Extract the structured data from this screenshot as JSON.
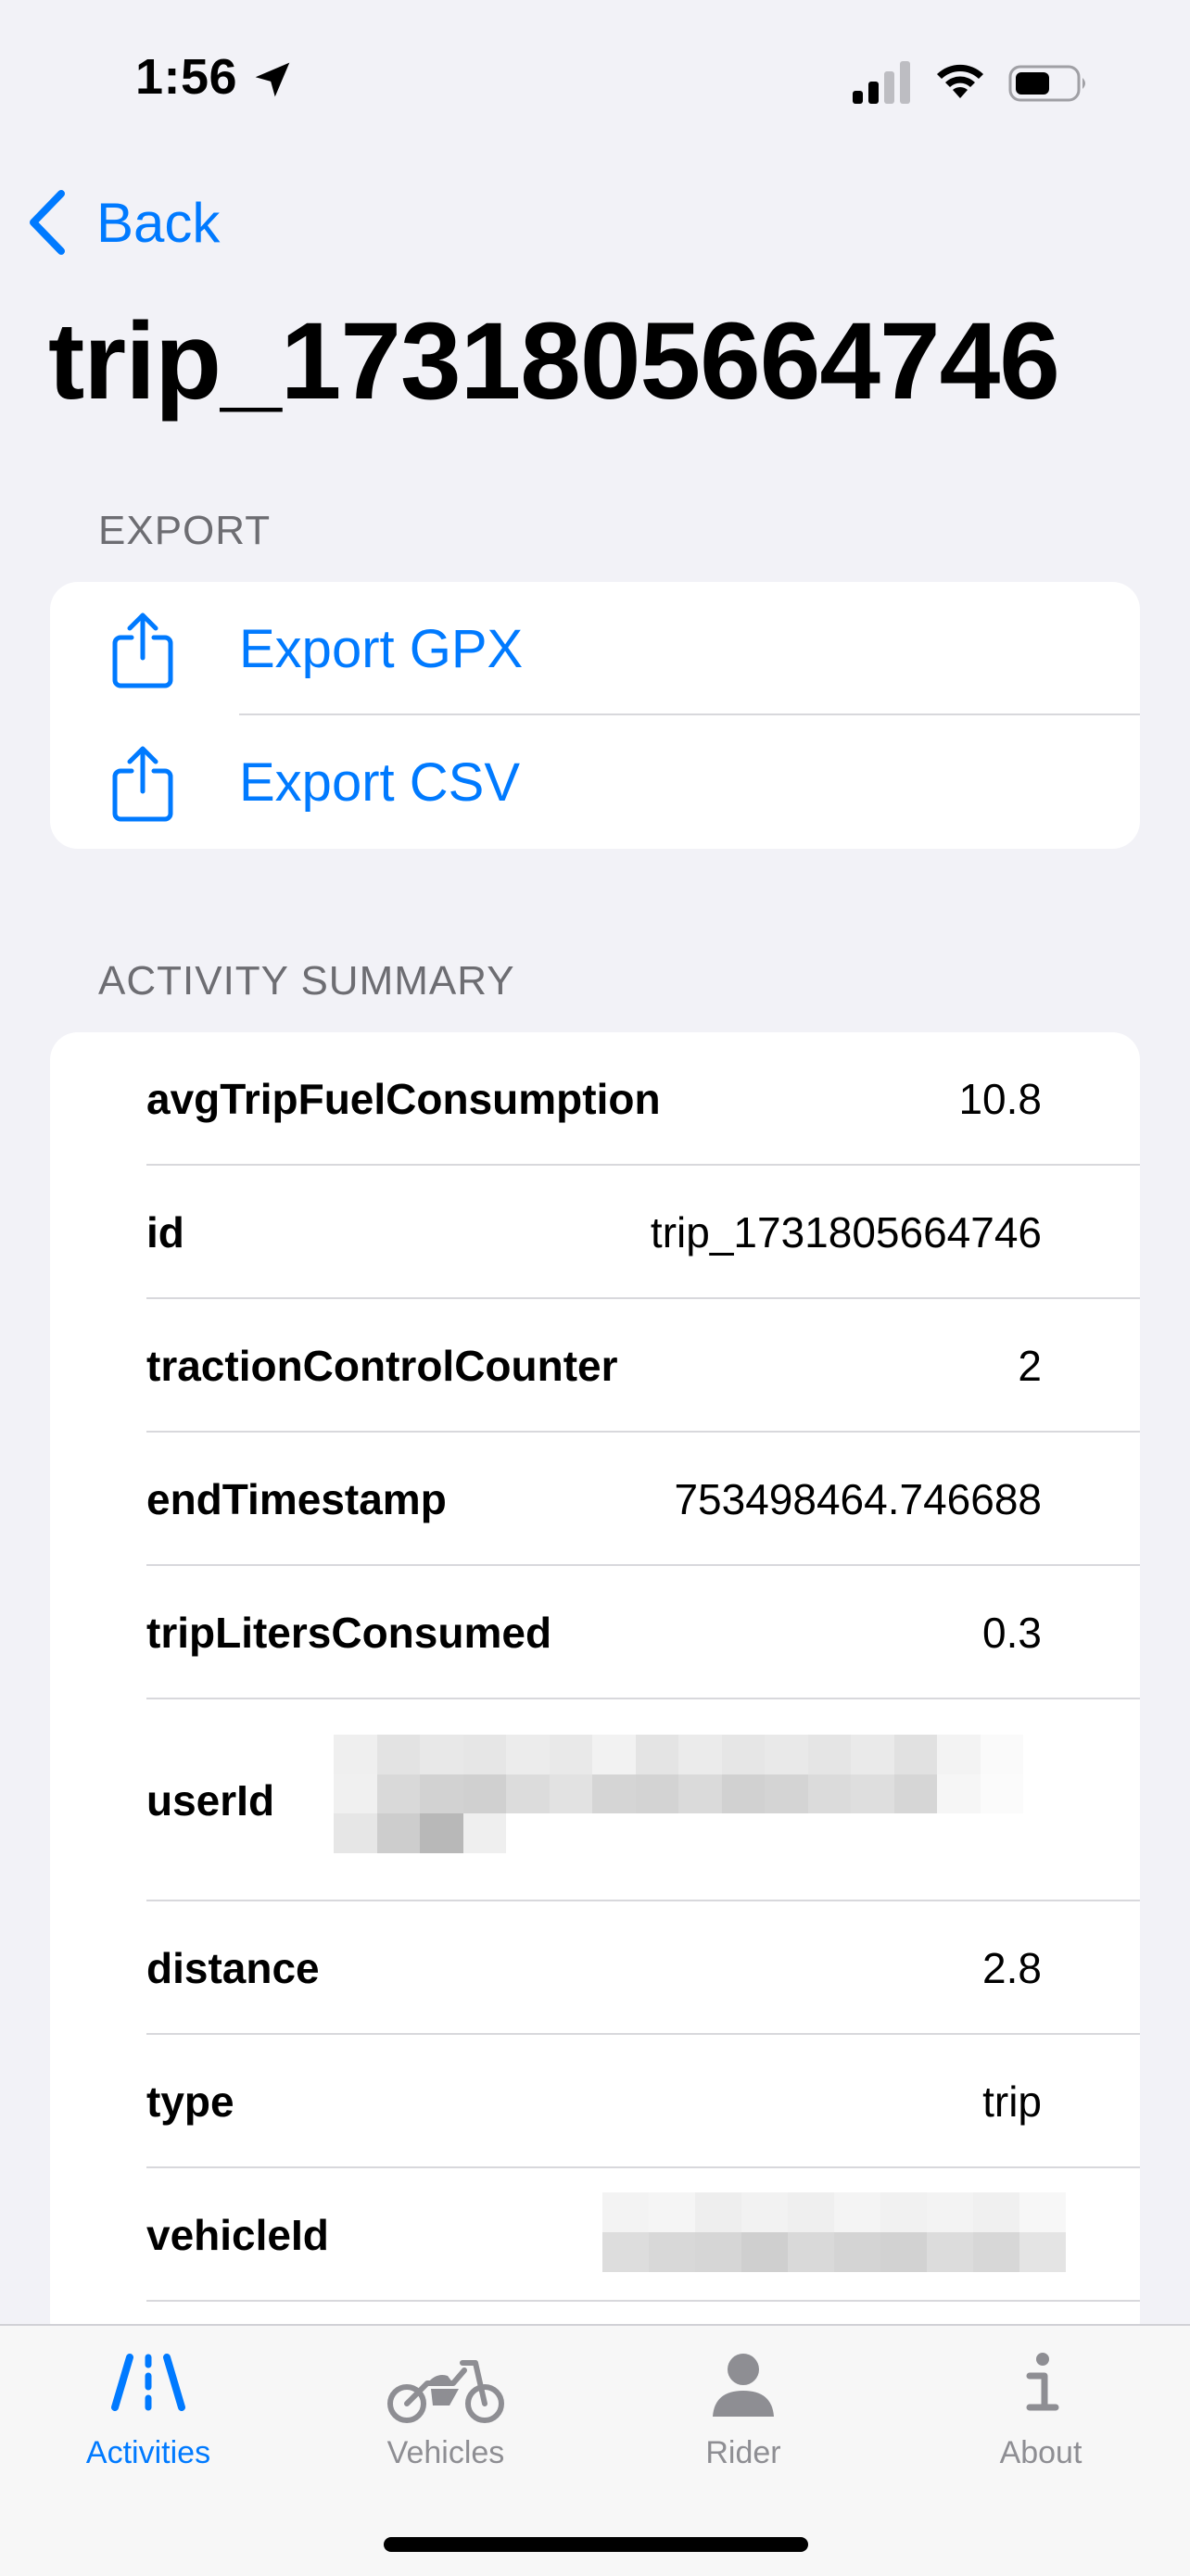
{
  "status_bar": {
    "time": "1:56"
  },
  "nav": {
    "back_label": "Back",
    "title": "trip_1731805664746"
  },
  "export_section": {
    "header": "EXPORT",
    "items": [
      {
        "label": "Export GPX",
        "icon": "share-icon"
      },
      {
        "label": "Export CSV",
        "icon": "share-icon"
      }
    ]
  },
  "summary_section": {
    "header": "ACTIVITY SUMMARY",
    "rows": [
      {
        "key": "avgTripFuelConsumption",
        "value": "10.8"
      },
      {
        "key": "id",
        "value": "trip_1731805664746"
      },
      {
        "key": "tractionControlCounter",
        "value": "2"
      },
      {
        "key": "endTimestamp",
        "value": "753498464.746688"
      },
      {
        "key": "tripLitersConsumed",
        "value": "0.3"
      },
      {
        "key": "userId",
        "value": ""
      },
      {
        "key": "distance",
        "value": "2.8"
      },
      {
        "key": "type",
        "value": "trip"
      },
      {
        "key": "vehicleId",
        "value": ""
      }
    ]
  },
  "tab_bar": {
    "tabs": [
      {
        "label": "Activities",
        "icon": "activities-icon",
        "active": true
      },
      {
        "label": "Vehicles",
        "icon": "motorcycle-icon",
        "active": false
      },
      {
        "label": "Rider",
        "icon": "person-icon",
        "active": false
      },
      {
        "label": "About",
        "icon": "info-icon",
        "active": false
      }
    ]
  },
  "colors": {
    "accent": "#007AFF",
    "background": "#F2F2F7",
    "secondary_text": "#6D6D72",
    "inactive_tab": "#8E8E93"
  }
}
